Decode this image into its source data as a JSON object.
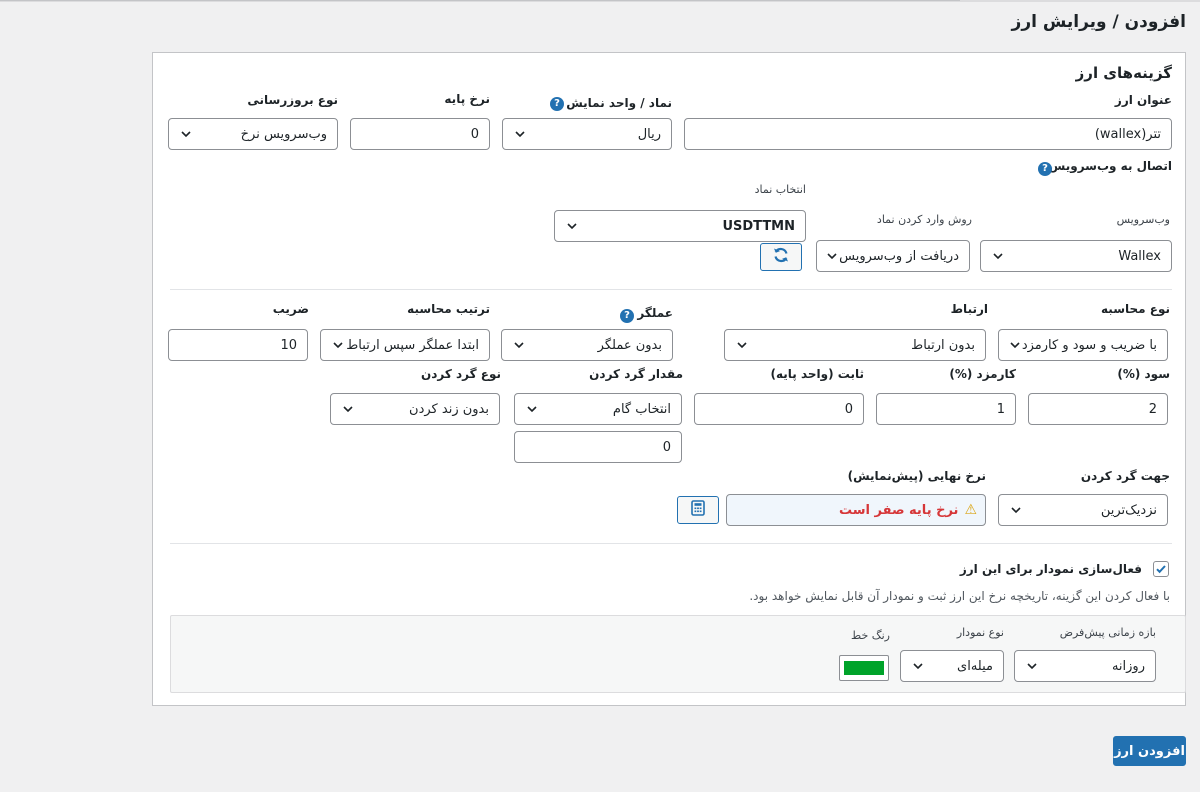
{
  "page": {
    "title": "افزودن / ویرایش ارز"
  },
  "options": {
    "section_title": "گزینه‌های ارز"
  },
  "row1": {
    "currency_title_label": "عنوان ارز",
    "currency_title_value": "تتر(wallex)",
    "symbol_label": "نماد / واحد نمایش",
    "symbol_value": "ریال",
    "base_rate_label": "نرخ پایه",
    "base_rate_value": "0",
    "update_type_label": "نوع بروزرسانی",
    "update_type_value": "وب‌سرویس نرخ"
  },
  "webservice": {
    "section_label": "اتصال به وب‌سرویس",
    "service_label": "وب‌سرویس",
    "service_value": "Wallex",
    "symbol_input_method_label": "روش وارد کردن نماد",
    "symbol_input_method_value": "دریافت از وب‌سرویس",
    "select_symbol_label": "انتخاب نماد",
    "select_symbol_value": "USDTTMN",
    "refresh_icon": "refresh-icon"
  },
  "calc": {
    "calc_type_label": "نوع محاسبه",
    "calc_type_value": "با ضریب و سود و کارمزد",
    "link_label": "ارتباط",
    "link_value": "بدون ارتباط",
    "operator_label": "عملگر",
    "operator_value": "بدون عملگر",
    "calc_order_label": "ترتیب محاسبه",
    "calc_order_value": "ابتدا عملگر سپس ارتباط",
    "multiplier_label": "ضریب",
    "multiplier_value": "10",
    "profit_label": "سود (%)",
    "profit_value": "2",
    "fee_label": "کارمزد (%)",
    "fee_value": "1",
    "fixed_label": "ثابت (واحد پایه)",
    "fixed_value": "0",
    "rounding_amount_label": "مقدار گرد کردن",
    "rounding_amount_value": "انتخاب گام",
    "rounding_amount_custom": "0",
    "rounding_type_label": "نوع گرد کردن",
    "rounding_type_value": "بدون زند کردن",
    "rounding_direction_label": "جهت گرد کردن",
    "rounding_direction_value": "نزدیک‌ترین",
    "final_rate_label": "نرخ نهایی (پیش‌نمایش)",
    "final_rate_value": "نرخ پایه صفر است",
    "warning_icon": "⚠",
    "calculator_icon": "calculator-icon"
  },
  "chart": {
    "enable_label": "فعال‌سازی نمودار برای این ارز",
    "enabled": true,
    "description": "با فعال کردن این گزینه، تاریخچه نرخ این ارز ثبت و نمودار آن قابل نمایش خواهد بود.",
    "default_period_label": "بازه زمانی پیش‌فرض",
    "default_period_value": "روزانه",
    "chart_type_label": "نوع نمودار",
    "chart_type_value": "میله‌ای",
    "line_color_label": "رنگ خط",
    "line_color": "#00a32a"
  },
  "actions": {
    "submit_label": "افزودن ارز"
  },
  "colors": {
    "accent": "#2271b1",
    "error": "#d63638",
    "background": "#f0f0f1"
  }
}
